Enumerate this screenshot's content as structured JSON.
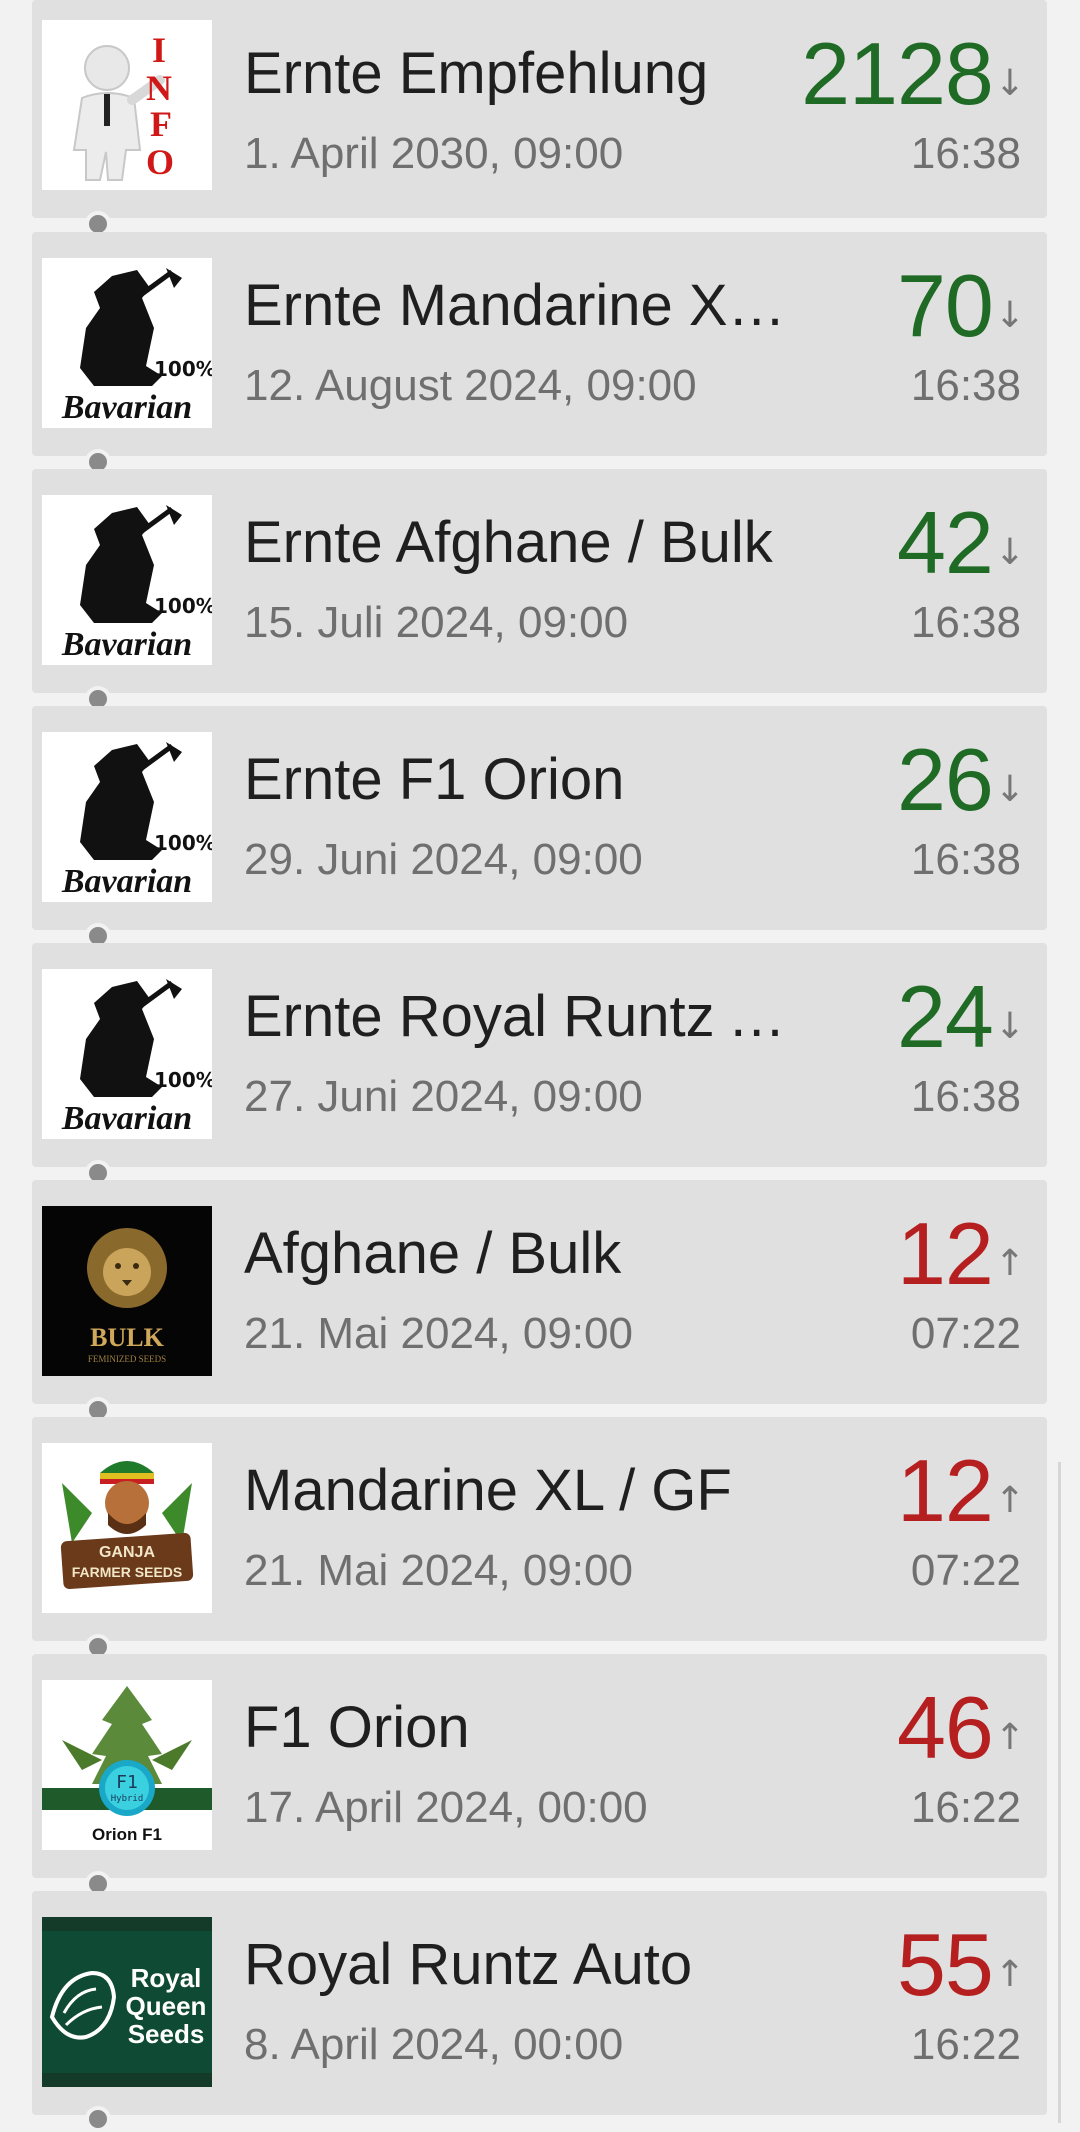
{
  "items": [
    {
      "title": "Ernte Empfehlung",
      "date": "1. April 2030, 09:00",
      "count": "2128",
      "trend": "down",
      "arrow": "↓",
      "time": "16:38",
      "thumb": "info-icon"
    },
    {
      "title": "Ernte Mandarine XL / GF",
      "date": "12. August 2024, 09:00",
      "count": "70",
      "trend": "down",
      "arrow": "↓",
      "time": "16:38",
      "thumb": "bavarian-logo",
      "logo_text": "Bavarian",
      "logo_badge": "100%"
    },
    {
      "title": "Ernte Afghane / Bulk",
      "date": "15. Juli 2024, 09:00",
      "count": "42",
      "trend": "down",
      "arrow": "↓",
      "time": "16:38",
      "thumb": "bavarian-logo",
      "logo_text": "Bavarian",
      "logo_badge": "100%"
    },
    {
      "title": "Ernte F1 Orion",
      "date": "29. Juni 2024, 09:00",
      "count": "26",
      "trend": "down",
      "arrow": "↓",
      "time": "16:38",
      "thumb": "bavarian-logo",
      "logo_text": "Bavarian",
      "logo_badge": "100%"
    },
    {
      "title": "Ernte Royal Runtz Auto",
      "date": "27. Juni 2024, 09:00",
      "count": "24",
      "trend": "down",
      "arrow": "↓",
      "time": "16:38",
      "thumb": "bavarian-logo",
      "logo_text": "Bavarian",
      "logo_badge": "100%"
    },
    {
      "title": "Afghane / Bulk",
      "date": "21. Mai 2024, 09:00",
      "count": "12",
      "trend": "up",
      "arrow": "↑",
      "time": "07:22",
      "thumb": "bulk-lion-logo",
      "logo_text": "BULK",
      "logo_sub": "FEMINIZED SEEDS"
    },
    {
      "title": "Mandarine XL / GF",
      "date": "21. Mai 2024, 09:00",
      "count": "12",
      "trend": "up",
      "arrow": "↑",
      "time": "07:22",
      "thumb": "ganja-farmer-logo",
      "logo_text": "GANJA",
      "logo_sub": "FARMER SEEDS"
    },
    {
      "title": "F1 Orion",
      "date": "17. April 2024, 00:00",
      "count": "46",
      "trend": "up",
      "arrow": "↑",
      "time": "16:22",
      "thumb": "orion-f1-logo",
      "logo_text": "Orion F1",
      "logo_badge": "F1",
      "logo_sub": "Hybrid"
    },
    {
      "title": "Royal Runtz Auto",
      "date": "8. April 2024, 00:00",
      "count": "55",
      "trend": "up",
      "arrow": "↑",
      "time": "16:22",
      "thumb": "royal-queen-logo",
      "logo_text": "Royal",
      "logo_sub": "Queen",
      "logo_badge": "Seeds"
    }
  ],
  "colors": {
    "down": "#1f6a24",
    "up": "#b51f1f",
    "card": "#e0e0e0",
    "background": "#f2f2f2"
  }
}
